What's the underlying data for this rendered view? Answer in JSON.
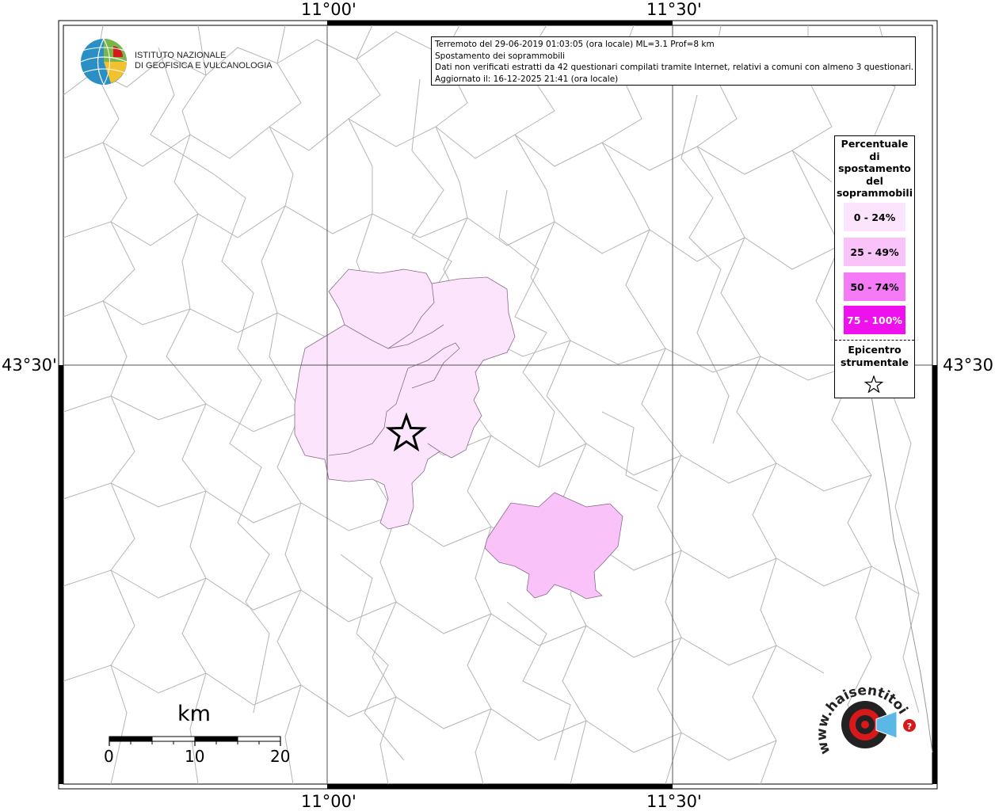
{
  "grid": {
    "lon_labels": [
      "11°00'",
      "11°30'"
    ],
    "lat_labels": [
      "43°30'"
    ]
  },
  "info": {
    "line1": "Terremoto del 29-06-2019 01:03:05 (ora locale) ML=3.1 Prof=8 km",
    "line2": "Spostamento dei soprammobili",
    "line3": "Dati non verificati estratti da 42 questionari compilati tramite Internet, relativi a comuni con almeno 3 questionari.",
    "line4": "Aggiornato il: 16-12-2025 21:41 (ora locale)"
  },
  "legend": {
    "title_lines": [
      "Percentuale",
      "di",
      "spostamento",
      "del",
      "soprammobili"
    ],
    "classes": [
      {
        "label": "0 - 24%",
        "color": "#fce4fc",
        "text_color": "#000000"
      },
      {
        "label": "25 - 49%",
        "color": "#f9c2f9",
        "text_color": "#000000"
      },
      {
        "label": "50 - 74%",
        "color": "#f57af5",
        "text_color": "#000000"
      },
      {
        "label": "75 - 100%",
        "color": "#ee11ee",
        "text_color": "#ffffff"
      }
    ],
    "epicenter_lines": [
      "Epicentro",
      "strumentale"
    ]
  },
  "logo_ingv": {
    "line1": "ISTITUTO NAZIONALE",
    "line2": "DI GEOFISICA E VULCANOLOGIA"
  },
  "logo_hsit": {
    "text": "www.haisentitoilterremoto.it",
    "accent": "#d7191c"
  },
  "scale_bar": {
    "unit": "km",
    "ticks": [
      "0",
      "10",
      "20"
    ]
  },
  "colors": {
    "border_lines": "#b5b5b5",
    "grid": "#555555"
  }
}
